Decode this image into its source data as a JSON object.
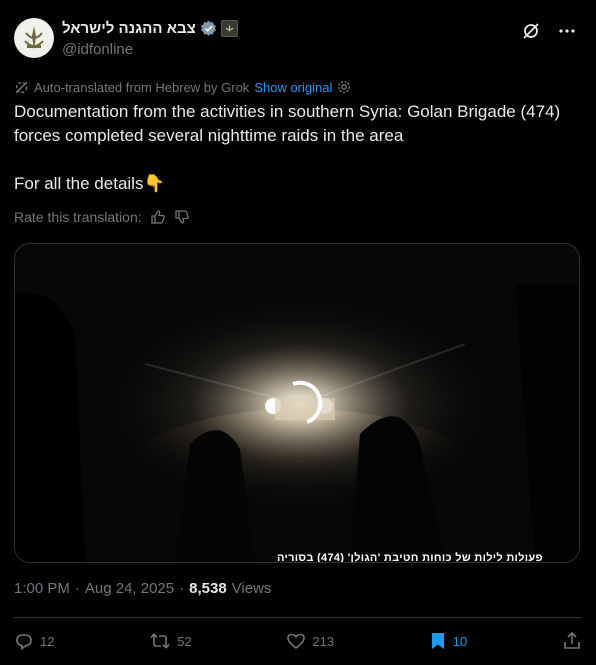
{
  "author": {
    "display_name": "צבא ההגנה לישראל",
    "handle": "@idfonline"
  },
  "translation": {
    "notice": "Auto-translated from Hebrew by Grok",
    "show_original": "Show original",
    "rate_label": "Rate this translation:"
  },
  "tweet": {
    "text": "Documentation from the activities in southern Syria: Golan Brigade (474) forces completed several nighttime raids in the area\n\nFor all the details👇"
  },
  "media": {
    "caption": "פעולות לילות של כוחות חטיבת 'הגולן' (474) בסוריה"
  },
  "meta": {
    "time": "1:00 PM",
    "separator1": "·",
    "date": "Aug 24, 2025",
    "separator2": "·",
    "views_count": "8,538",
    "views_label": "Views"
  },
  "actions": {
    "replies": "12",
    "reposts": "52",
    "likes": "213",
    "bookmarks": "10"
  },
  "colors": {
    "background": "#000000",
    "text": "#e7e9ea",
    "muted": "#71767b",
    "accent": "#1d9bf0"
  },
  "icons": [
    "verified-badge-icon",
    "affiliate-badge-icon",
    "grok-icon",
    "more-icon",
    "translate-icon",
    "settings-icon",
    "thumbs-up-icon",
    "thumbs-down-icon",
    "reply-icon",
    "repost-icon",
    "like-icon",
    "bookmark-icon",
    "share-icon"
  ]
}
